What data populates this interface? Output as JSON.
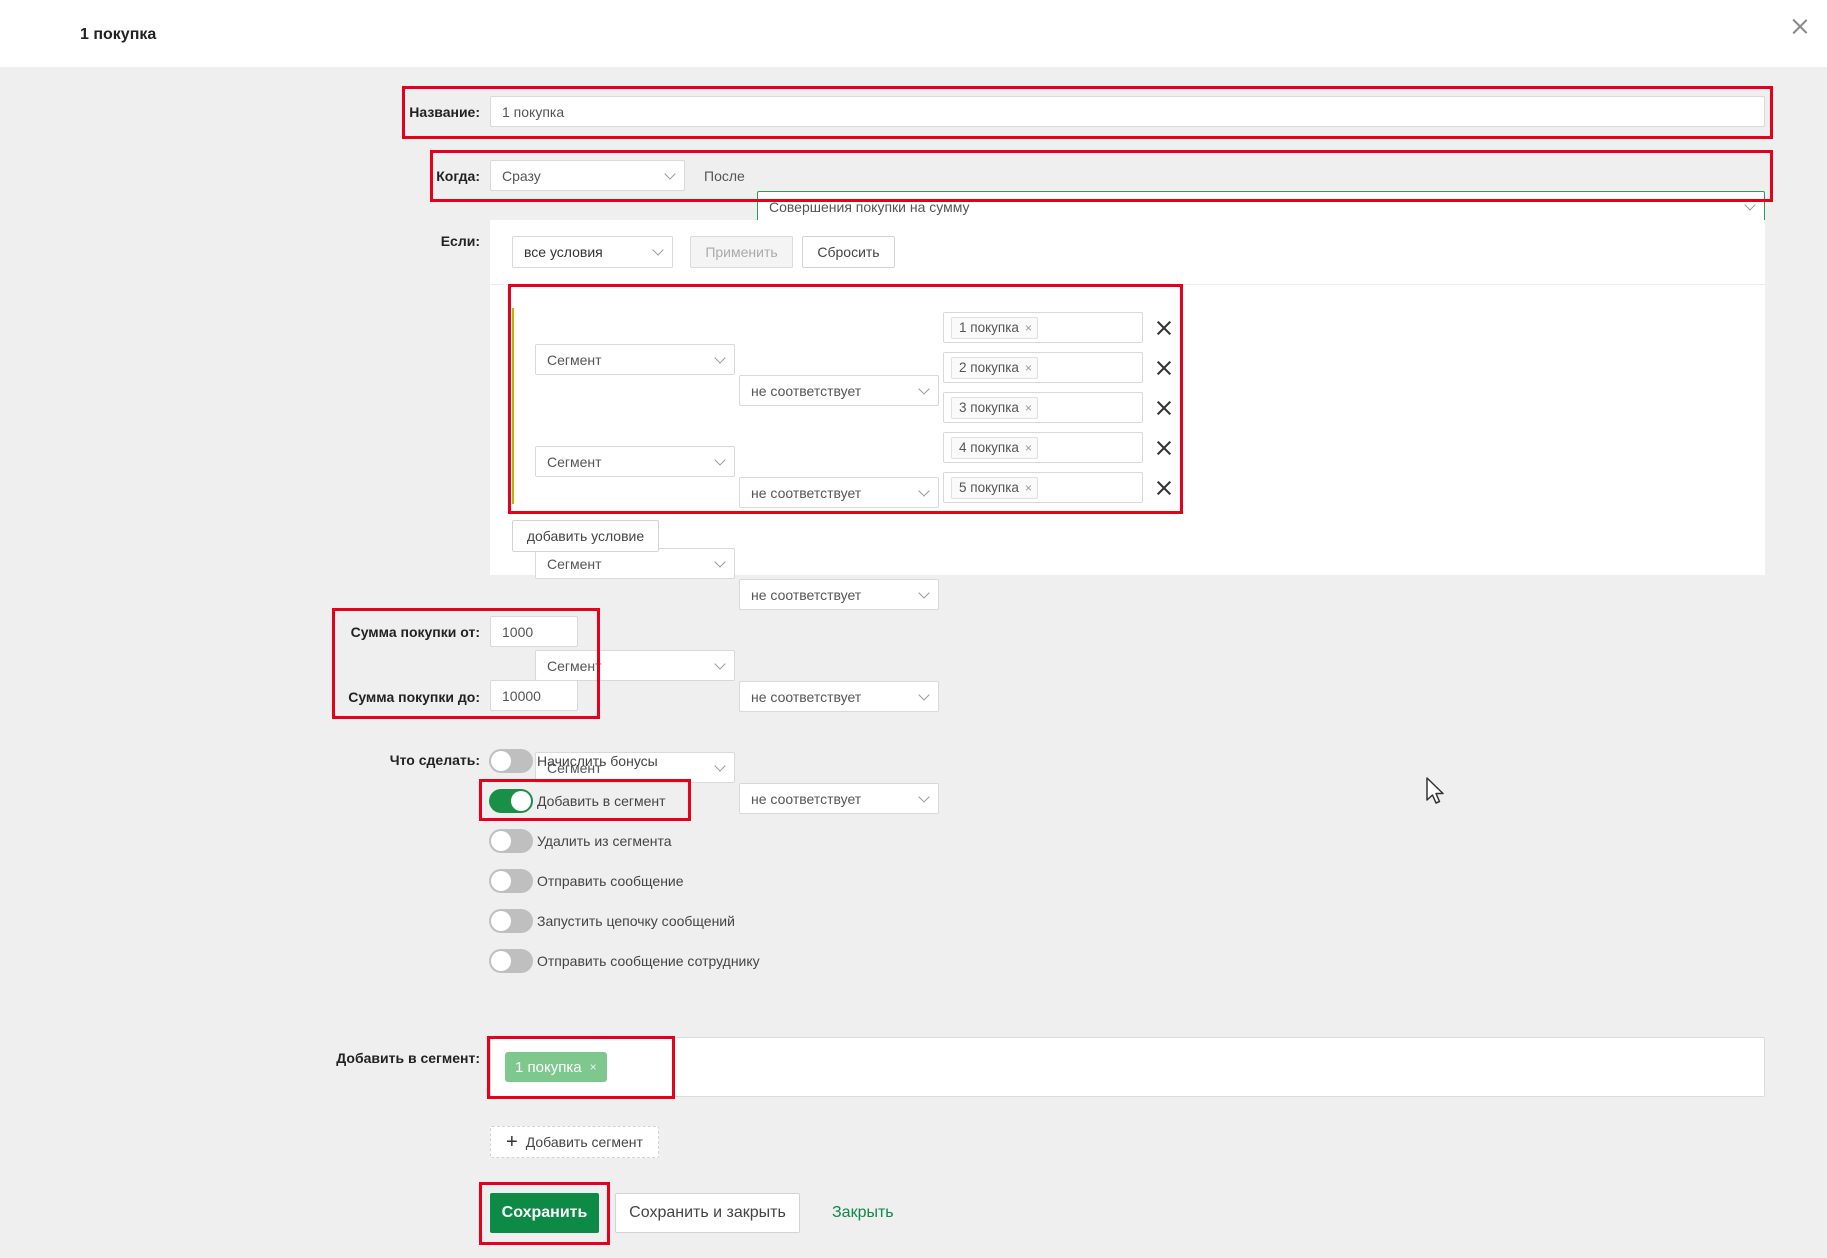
{
  "header": {
    "title": "1 покупка"
  },
  "form": {
    "name": {
      "label": "Название:",
      "value": "1 покупка"
    },
    "when": {
      "label": "Когда:",
      "timing_value": "Сразу",
      "after_label": "После",
      "event_value": "Совершения покупки на сумму"
    },
    "if": {
      "label": "Если:",
      "mode_value": "все условия",
      "apply_button": "Применить",
      "reset_button": "Сбросить",
      "conditions": [
        {
          "field": "Сегмент",
          "operator": "не соответствует",
          "tag": "1 покупка"
        },
        {
          "field": "Сегмент",
          "operator": "не соответствует",
          "tag": "2 покупка"
        },
        {
          "field": "Сегмент",
          "operator": "не соответствует",
          "tag": "3 покупка"
        },
        {
          "field": "Сегмент",
          "operator": "не соответствует",
          "tag": "4 покупка"
        },
        {
          "field": "Сегмент",
          "operator": "не соответствует",
          "tag": "5 покупка"
        }
      ],
      "add_condition_button": "добавить условие"
    },
    "sum_from": {
      "label": "Сумма покупки от:",
      "value": "1000"
    },
    "sum_to": {
      "label": "Сумма покупки до:",
      "value": "10000"
    },
    "actions": {
      "label": "Что сделать:",
      "items": [
        {
          "label": "Начислить бонусы",
          "on": false
        },
        {
          "label": "Добавить в сегмент",
          "on": true
        },
        {
          "label": "Удалить из сегмента",
          "on": false
        },
        {
          "label": "Отправить сообщение",
          "on": false
        },
        {
          "label": "Запустить цепочку сообщений",
          "on": false
        },
        {
          "label": "Отправить сообщение сотруднику",
          "on": false
        }
      ]
    },
    "add_to_segment": {
      "label": "Добавить в сегмент:",
      "tag": "1 покупка",
      "add_button": "Добавить сегмент"
    }
  },
  "footer": {
    "save": "Сохранить",
    "save_close": "Сохранить и закрыть",
    "close": "Закрыть"
  },
  "colors": {
    "primary": "#0d8a45",
    "highlight": "#e6001b",
    "toggle_on": "#1a8f46",
    "segment_tag": "#7fc88d"
  }
}
